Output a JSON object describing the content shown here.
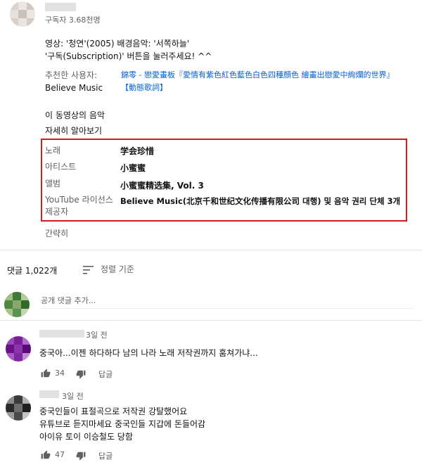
{
  "channel": {
    "name_hidden": "",
    "subscribers": "구독자 3.68천명"
  },
  "description": {
    "line1": "영상: '청연'(2005)  배경음악: '서쪽하늘'",
    "line2": "'구독(Subscription)' 버튼을 눌러주세요! ^^",
    "recommended_label": "추천한 사용자:",
    "recommended_value": "錦零 - 戀愛畫板『愛情有紫色紅色藍色白色四種顏色 繪畫出戀愛中絢爛的世界』",
    "recommended_source": "Believe Music",
    "recommended_tag": "【動態歌詞】"
  },
  "music_section": {
    "title": "이 동영상의 음악",
    "more": "자세히 알아보기",
    "rows": [
      {
        "label": "노래",
        "value": "学会珍惜"
      },
      {
        "label": "아티스트",
        "value": "小蜜蜜"
      },
      {
        "label": "앨범",
        "value": "小蜜蜜精选集, Vol. 3"
      },
      {
        "label": "YouTube 라이선스 제공자",
        "value": "Believe Music(北京千和世纪文化传播有限公司 대행) 및 음악 권리 단체 3개"
      }
    ],
    "collapse": "간략히"
  },
  "comments": {
    "count": "댓글 1,022개",
    "sort": "정렬 기준",
    "add_placeholder": "공개 댓글 추가...",
    "items": [
      {
        "time": "3일 전",
        "text": "중국아...이젠 하다하다 남의 나라 노래 저작권까지 훔쳐가냐...",
        "likes": "34",
        "reply": "답글"
      },
      {
        "time": "3일 전",
        "line1": "중국인들이 표절곡으로 저작권 강탈했어요",
        "line2": "유튜브로 듣지마세요 중국인들 지갑에 돈들어감",
        "line3": "아이유 토이 이승철도 당함",
        "likes": "47",
        "reply": "답글"
      }
    ]
  },
  "colors": {
    "accent_red": "#d81c1c",
    "link_blue": "#065fd4",
    "muted": "#606060"
  },
  "icons": [
    "sort-icon",
    "thumb-up-icon",
    "thumb-down-icon"
  ]
}
